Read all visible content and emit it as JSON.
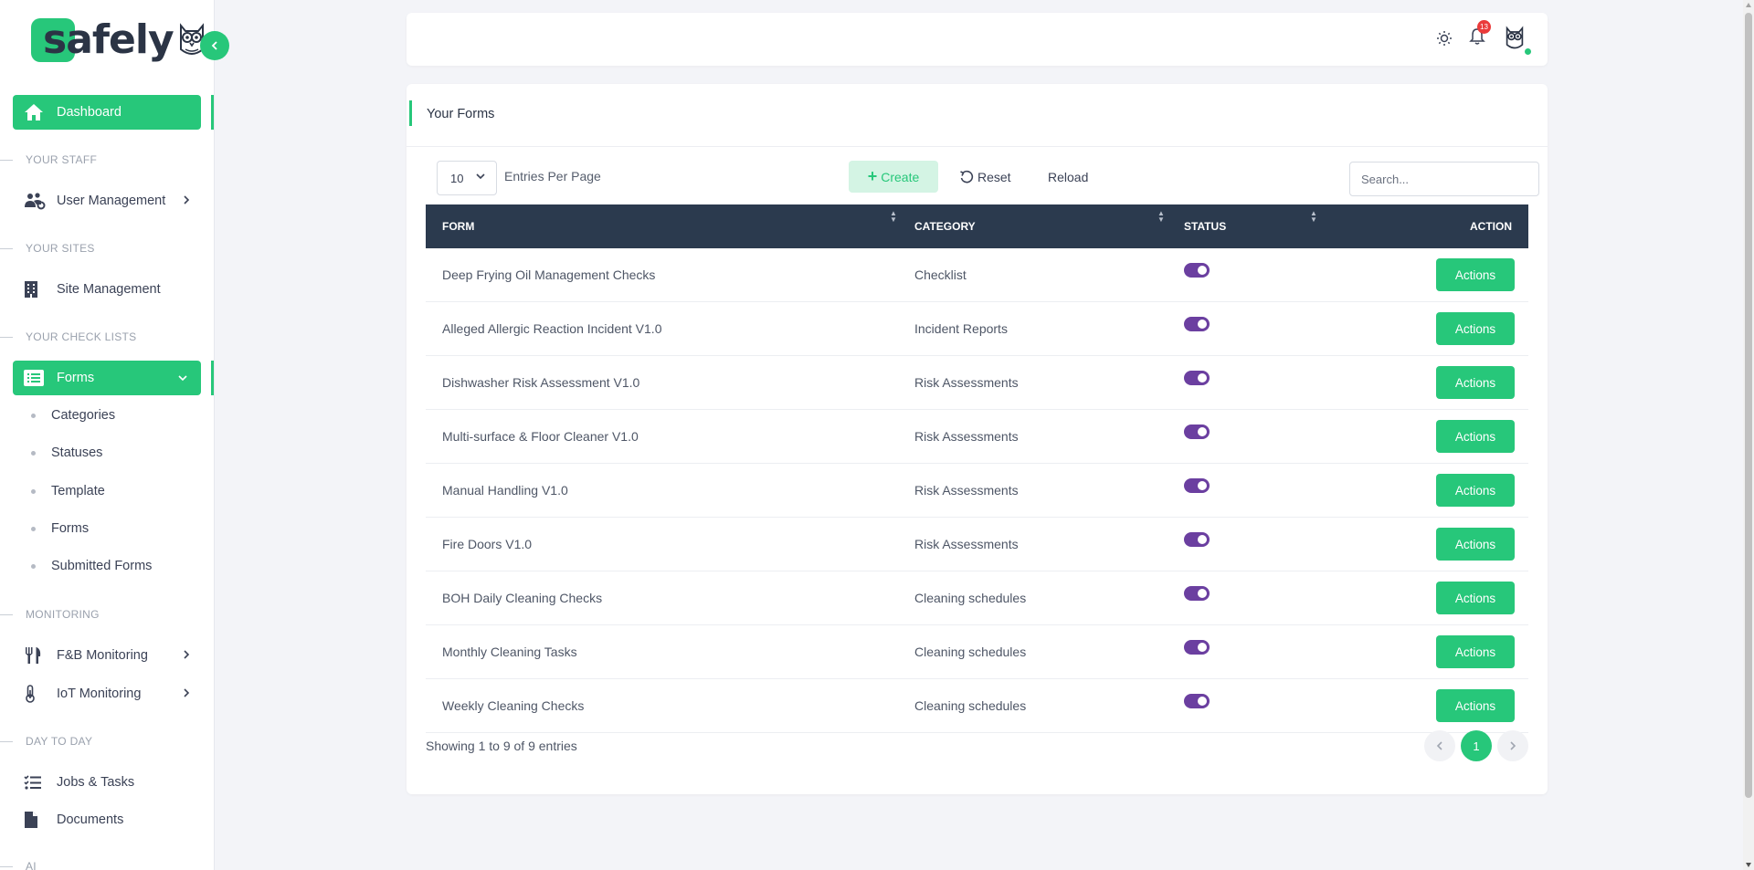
{
  "app": {
    "logo_text": "safely"
  },
  "sidebar": {
    "dashboard": "Dashboard",
    "sections": {
      "staff": "YOUR STAFF",
      "sites": "YOUR SITES",
      "checklists": "YOUR CHECK LISTS",
      "monitoring": "MONITORING",
      "day_to_day": "DAY TO DAY",
      "ai": "AI"
    },
    "user_management": "User Management",
    "site_management": "Site Management",
    "forms": "Forms",
    "forms_sub": [
      "Categories",
      "Statuses",
      "Template",
      "Forms",
      "Submitted Forms"
    ],
    "fb_monitoring": "F&B Monitoring",
    "iot_monitoring": "IoT Monitoring",
    "jobs_tasks": "Jobs & Tasks",
    "documents": "Documents"
  },
  "topbar": {
    "notification_count": "13"
  },
  "card": {
    "title": "Your Forms",
    "entries_value": "10",
    "entries_label": "Entries Per Page",
    "create_label": "Create",
    "reset_label": "Reset",
    "reload_label": "Reload",
    "search_placeholder": "Search..."
  },
  "table": {
    "headers": {
      "form": "FORM",
      "category": "CATEGORY",
      "status": "STATUS",
      "action": "ACTION"
    },
    "action_label": "Actions",
    "rows": [
      {
        "form": "Deep Frying Oil Management Checks",
        "category": "Checklist",
        "status": "on"
      },
      {
        "form": "Alleged Allergic Reaction Incident V1.0",
        "category": "Incident Reports",
        "status": "on"
      },
      {
        "form": "Dishwasher Risk Assessment V1.0",
        "category": "Risk Assessments",
        "status": "on"
      },
      {
        "form": "Multi-surface & Floor Cleaner V1.0",
        "category": "Risk Assessments",
        "status": "on"
      },
      {
        "form": "Manual Handling V1.0",
        "category": "Risk Assessments",
        "status": "on"
      },
      {
        "form": "Fire Doors V1.0",
        "category": "Risk Assessments",
        "status": "on"
      },
      {
        "form": "BOH Daily Cleaning Checks",
        "category": "Cleaning schedules",
        "status": "on"
      },
      {
        "form": "Monthly Cleaning Tasks",
        "category": "Cleaning schedules",
        "status": "on"
      },
      {
        "form": "Weekly Cleaning Checks",
        "category": "Cleaning schedules",
        "status": "on"
      }
    ]
  },
  "footer": {
    "showing": "Showing 1 to 9 of 9 entries",
    "current_page": "1"
  },
  "colors": {
    "accent": "#27c77a",
    "header_dark": "#2b3a4e",
    "toggle": "#6b3fa0",
    "badge": "#ea3a3a"
  }
}
